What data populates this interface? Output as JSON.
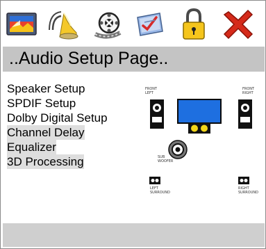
{
  "toolbar": {
    "icons": [
      {
        "name": "display-icon"
      },
      {
        "name": "audio-icon"
      },
      {
        "name": "film-reel-icon"
      },
      {
        "name": "preferences-icon"
      },
      {
        "name": "lock-icon"
      },
      {
        "name": "close-icon"
      }
    ]
  },
  "page": {
    "title": "..Audio Setup Page.."
  },
  "menu": {
    "items": [
      {
        "label": "Speaker Setup"
      },
      {
        "label": "SPDIF Setup"
      },
      {
        "label": "Dolby Digital Setup"
      },
      {
        "label": "Channel Delay"
      },
      {
        "label": "Equalizer"
      },
      {
        "label": "3D Processing"
      }
    ]
  },
  "diagram": {
    "front_left_1": "FRONT",
    "front_left_2": "LEFT",
    "front_right_1": "FRONT",
    "front_right_2": "RIGHT",
    "sub_1": "SUB",
    "sub_2": "WOOFER",
    "left_surround_1": "LEFT",
    "left_surround_2": "SURROUND",
    "right_surround_1": "RIGHT",
    "right_surround_2": "SURROUND"
  },
  "colors": {
    "title_bar": "#c4c4c4",
    "screen_blue": "#1e6fe0",
    "speaker_yellow": "#f2d61a",
    "close_red": "#d52a1a"
  }
}
